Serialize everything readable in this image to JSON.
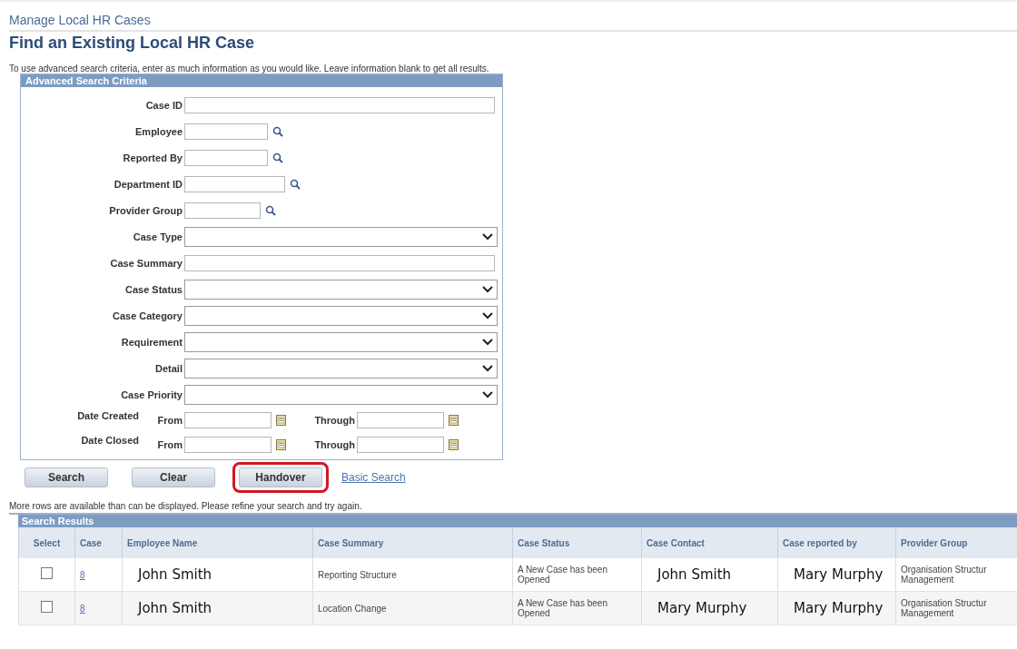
{
  "breadcrumb": "Manage Local HR Cases",
  "title": "Find an Existing Local HR Case",
  "instructions": "To use advanced search criteria, enter as much information as you would like. Leave information blank to get all results.",
  "criteria": {
    "header": "Advanced Search Criteria",
    "fields": [
      {
        "label": "Case ID",
        "kind": "text"
      },
      {
        "label": "Employee",
        "kind": "lookup"
      },
      {
        "label": "Reported By",
        "kind": "lookup"
      },
      {
        "label": "Department ID",
        "kind": "lookup-wide"
      },
      {
        "label": "Provider Group",
        "kind": "lookup-short"
      },
      {
        "label": "Case Type",
        "kind": "select"
      },
      {
        "label": "Case Summary",
        "kind": "text"
      },
      {
        "label": "Case Status",
        "kind": "select"
      },
      {
        "label": "Case Category",
        "kind": "select"
      },
      {
        "label": "Requirement",
        "kind": "select"
      },
      {
        "label": "Detail",
        "kind": "select"
      },
      {
        "label": "Case Priority",
        "kind": "select"
      },
      {
        "label": "Date Created",
        "kind": "daterange",
        "from_label": "From",
        "through_label": "Through"
      },
      {
        "label": "Date Closed",
        "kind": "daterange",
        "from_label": "From",
        "through_label": "Through"
      }
    ]
  },
  "buttons": [
    {
      "label": "Search",
      "highlighted": false
    },
    {
      "label": "Clear",
      "highlighted": false
    },
    {
      "label": "Handover",
      "highlighted": true
    }
  ],
  "basic_search_link": "Basic Search",
  "notice": "More rows are available than can be displayed. Please refine your search and try again.",
  "results": {
    "header": "Search Results",
    "columns": [
      {
        "label": "Select",
        "kind": "checkbox"
      },
      {
        "label": "Case",
        "kind": "link"
      },
      {
        "label": "Employee Name",
        "kind": "name"
      },
      {
        "label": "Case Summary",
        "kind": "text"
      },
      {
        "label": "Case Status",
        "kind": "text"
      },
      {
        "label": "Case Contact",
        "kind": "name"
      },
      {
        "label": "Case reported by",
        "kind": "name"
      },
      {
        "label": "Provider Group",
        "kind": "text"
      }
    ],
    "rows": [
      {
        "selected": false,
        "cells": [
          "",
          "8",
          "John Smith",
          "Reporting Structure",
          "A New Case has been Opened",
          "John Smith",
          "Mary Murphy",
          "Organisation Structur Management"
        ]
      },
      {
        "selected": false,
        "cells": [
          "",
          "8",
          "John Smith",
          "Location Change",
          "A New Case has been Opened",
          "Mary Murphy",
          "Mary Murphy",
          "Organisation Structur Management"
        ]
      }
    ]
  }
}
